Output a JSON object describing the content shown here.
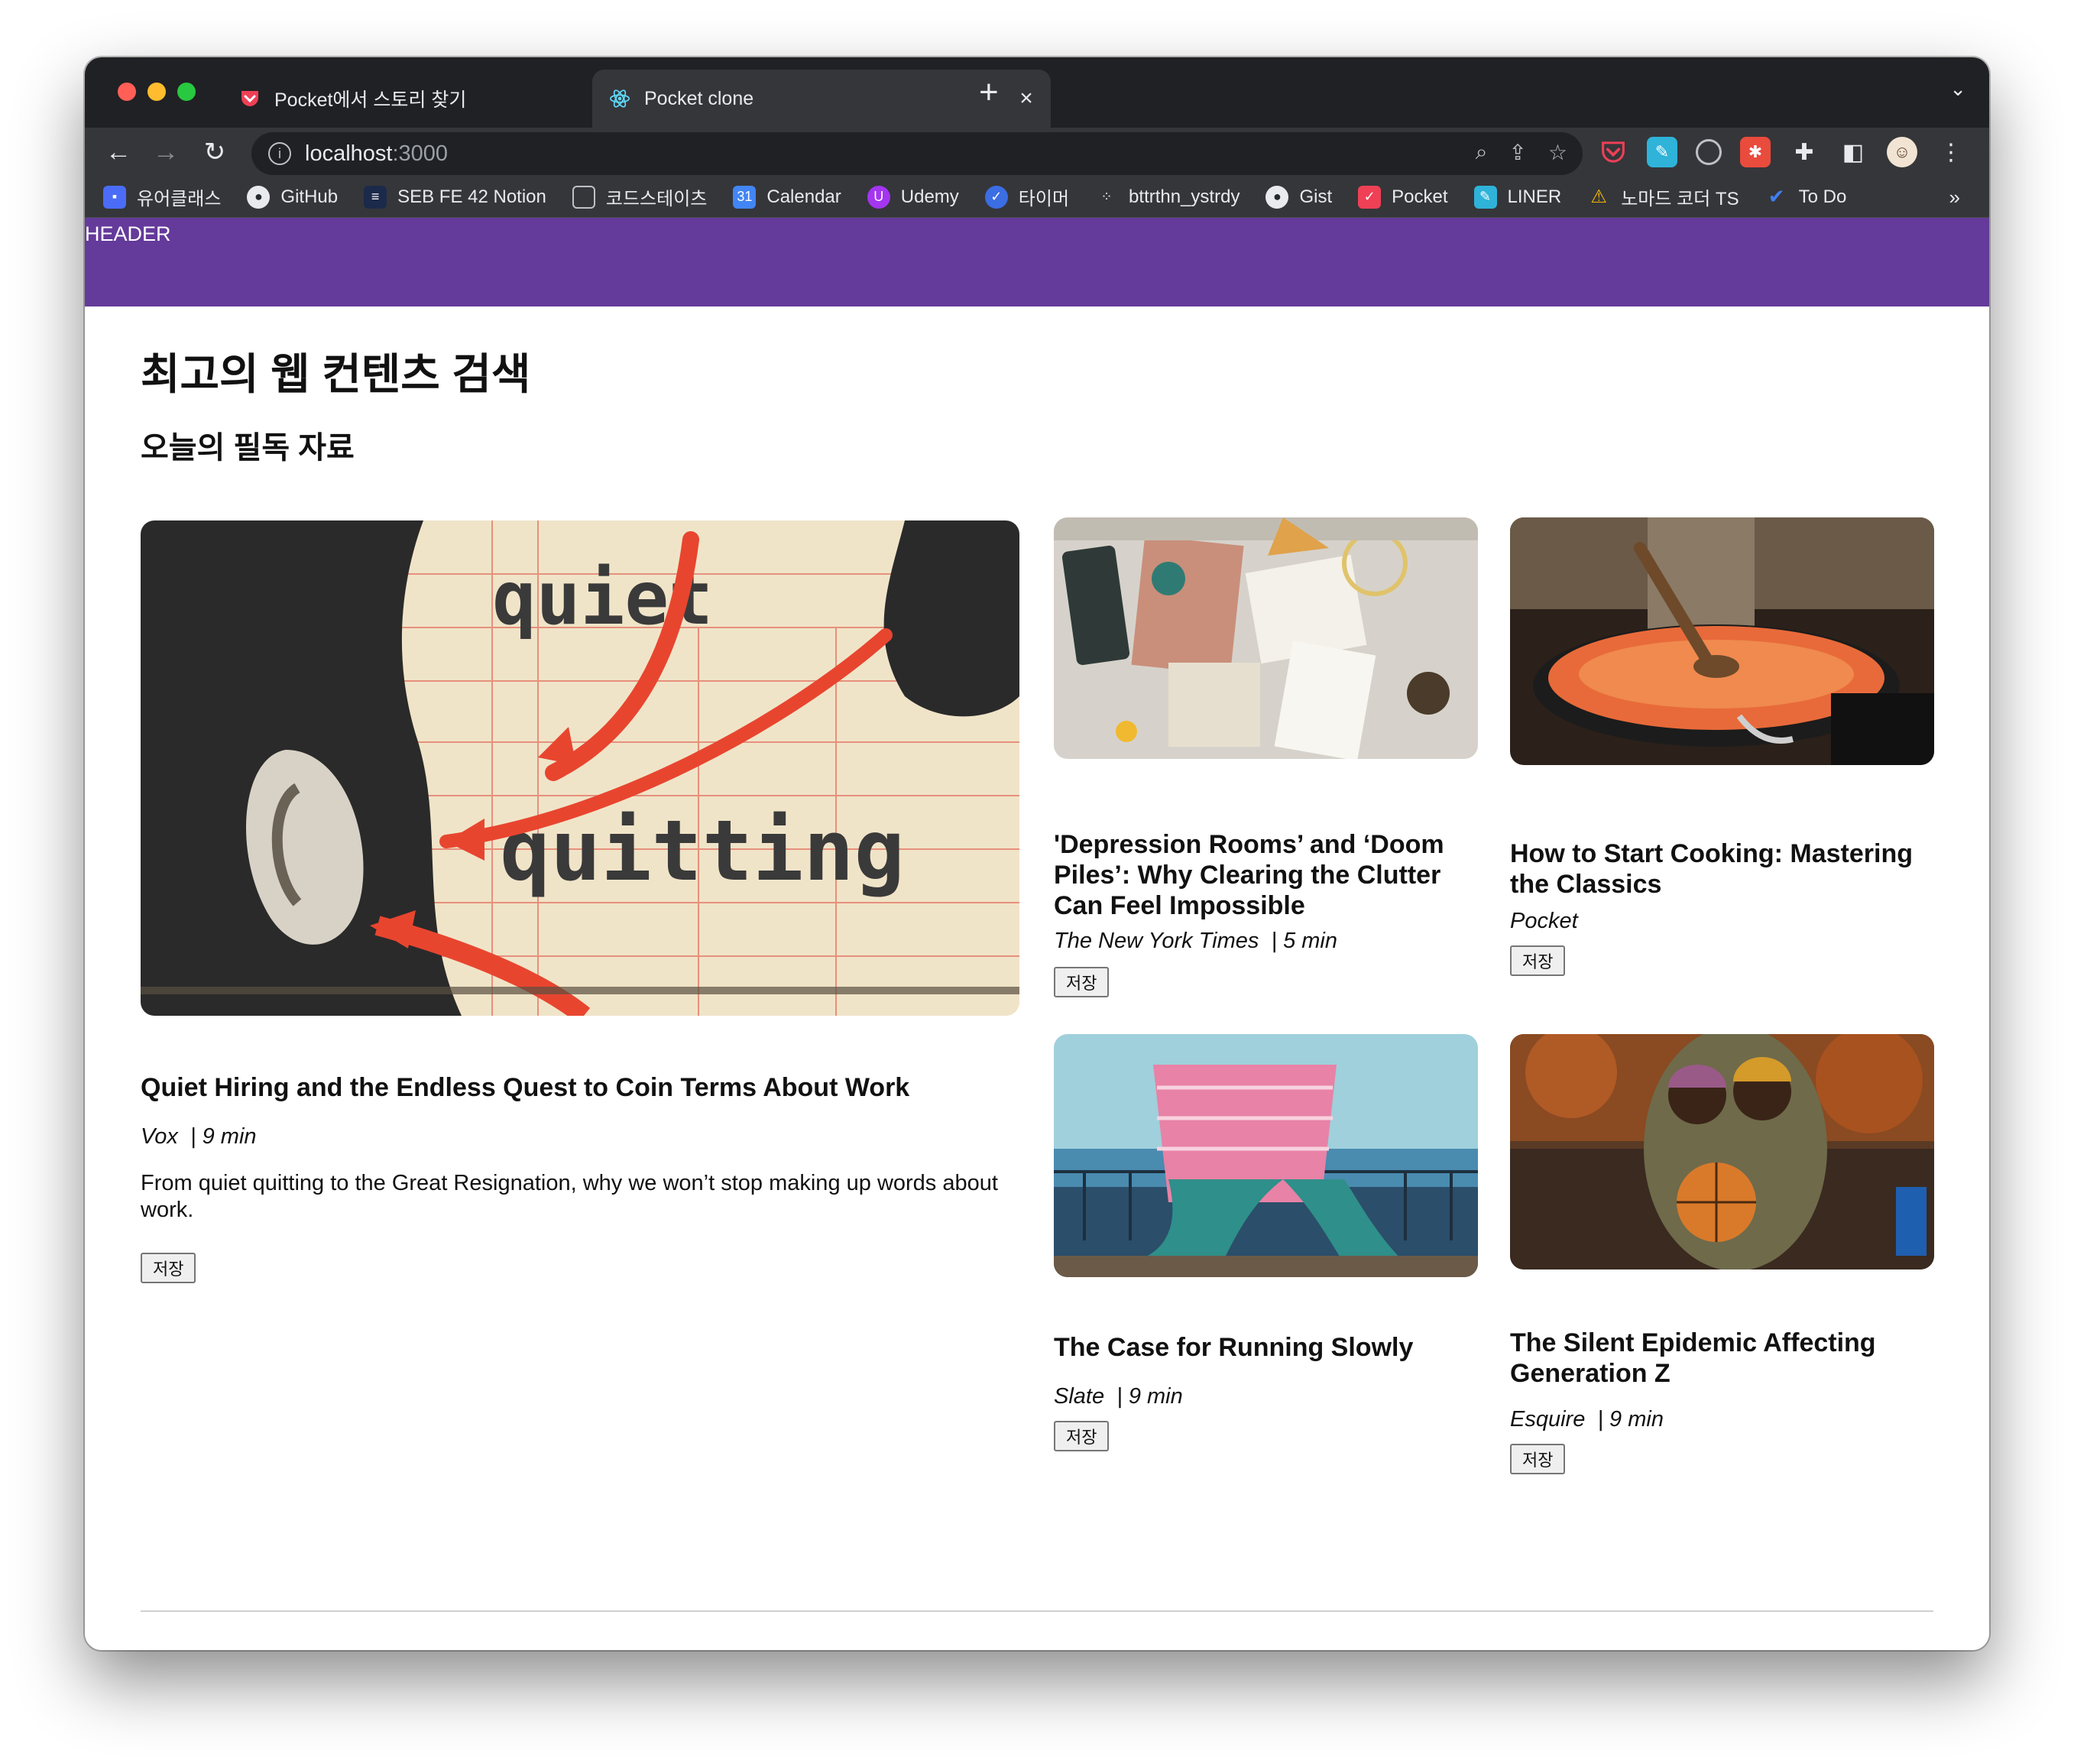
{
  "browser": {
    "tabs": [
      {
        "title": "Pocket에서 스토리 찾기",
        "icon": "pocket-icon",
        "active": false
      },
      {
        "title": "Pocket clone",
        "icon": "react-icon",
        "active": true
      }
    ],
    "new_tab": "+",
    "tabs_menu": "⌄",
    "url": {
      "host": "localhost",
      "port": ":3000"
    },
    "bookmarks": [
      {
        "label": "유어클래스",
        "icon": "codestates-icon",
        "color": "#4a6cf7"
      },
      {
        "label": "GitHub",
        "icon": "github-icon",
        "color": "#24292e"
      },
      {
        "label": "SEB FE 42 Notion",
        "icon": "notion-icon",
        "color": "#1b2a4a"
      },
      {
        "label": "코드스테이츠",
        "icon": "folder-icon",
        "color": "#5f6368"
      },
      {
        "label": "Calendar",
        "icon": "calendar-icon",
        "color": "#4285f4"
      },
      {
        "label": "Udemy",
        "icon": "udemy-icon",
        "color": "#a435f0"
      },
      {
        "label": "타이머",
        "icon": "timer-icon",
        "color": "#3b6de3"
      },
      {
        "label": "bttrthn_ystrdy",
        "icon": "dots-icon",
        "color": "#35363a"
      },
      {
        "label": "Gist",
        "icon": "github-icon",
        "color": "#24292e"
      },
      {
        "label": "Pocket",
        "icon": "pocket-icon",
        "color": "#ef4056"
      },
      {
        "label": "LINER",
        "icon": "liner-icon",
        "color": "#2fb3d9"
      },
      {
        "label": "노마드 코더 TS",
        "icon": "nomad-icon",
        "color": "#f2b705"
      },
      {
        "label": "To Do",
        "icon": "todo-icon",
        "color": "#2564cf"
      }
    ],
    "bookmarks_more": "»"
  },
  "page": {
    "header": "HEADER",
    "heading": "최고의 웹 컨텐츠 검색",
    "subheading": "오늘의 필독 자료",
    "save_label": "저장",
    "articles": [
      {
        "title": "Quiet Hiring and the Endless Quest to Coin Terms About Work",
        "source": "Vox",
        "time": "| 9 min",
        "excerpt": "From quiet quitting to the Great Resignation, why we won’t stop making up words about work.",
        "image": "quiet-quitting-collage",
        "image_words": [
          "quiet",
          "quitting"
        ]
      },
      {
        "title": "'Depression Rooms’ and ‘Doom Piles’: Why Clearing the Clutter Can Feel Impossible",
        "source": "The New York Times",
        "time": "| 5 min",
        "image": "cluttered-desk"
      },
      {
        "title": "How to Start Cooking: Mastering the Classics",
        "source": "Pocket",
        "time": "",
        "image": "pan-on-stove"
      },
      {
        "title": "The Case for Running Slowly",
        "source": "Slate",
        "time": "| 9 min",
        "image": "stretched-runner"
      },
      {
        "title": "The Silent Epidemic Affecting Generation Z",
        "source": "Esquire",
        "time": "| 9 min",
        "image": "two-people-with-basketball"
      }
    ]
  },
  "colors": {
    "header_bg": "#643a9a",
    "chrome_dark": "#202124",
    "chrome_toolbar": "#35363a"
  }
}
